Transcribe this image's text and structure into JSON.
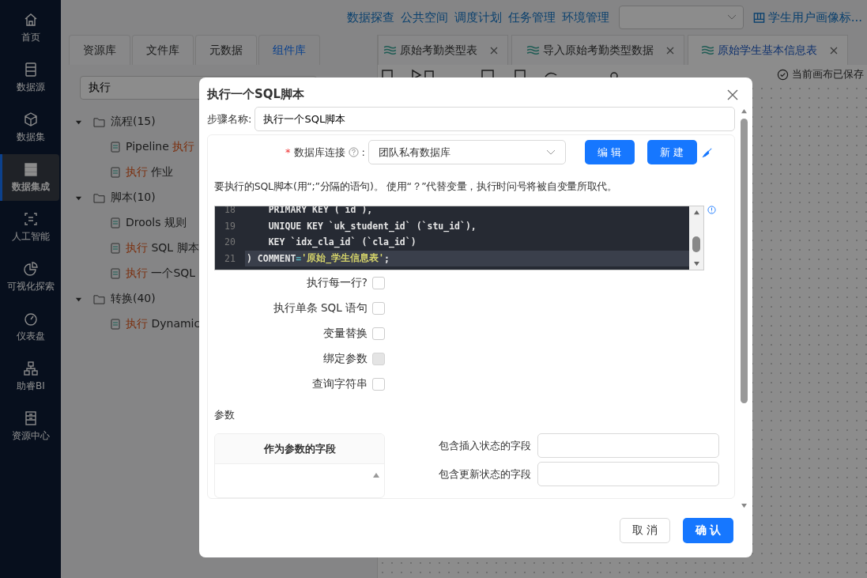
{
  "sidebar": {
    "items": [
      {
        "label": "首页",
        "selected": false
      },
      {
        "label": "数据源",
        "selected": false
      },
      {
        "label": "数据集",
        "selected": false
      },
      {
        "label": "数据集成",
        "selected": true
      },
      {
        "label": "人工智能",
        "selected": false
      },
      {
        "label": "可视化探索",
        "selected": false
      },
      {
        "label": "仪表盘",
        "selected": false
      },
      {
        "label": "助睿BI",
        "selected": false
      },
      {
        "label": "资源中心",
        "selected": false
      }
    ]
  },
  "top_nav": {
    "links": [
      "数据探查",
      "公共空间",
      "调度计划",
      "任务管理",
      "环境管理"
    ],
    "project": "学生用户画像标..."
  },
  "library_tabs": [
    {
      "label": "资源库",
      "selected": false
    },
    {
      "label": "文件库",
      "selected": false
    },
    {
      "label": "元数据",
      "selected": false
    },
    {
      "label": "组件库",
      "selected": true
    }
  ],
  "library_search": {
    "value": "执行"
  },
  "tree": [
    {
      "label": "流程(15)",
      "expanded": true,
      "children": [
        {
          "parts": [
            {
              "text": "Pipeline ",
              "match": false
            },
            {
              "text": "执行",
              "match": true
            }
          ]
        },
        {
          "parts": [
            {
              "text": "执行",
              "match": true
            },
            {
              "text": " 作业",
              "match": false
            }
          ]
        }
      ]
    },
    {
      "label": "脚本(10)",
      "expanded": true,
      "children": [
        {
          "parts": [
            {
              "text": "Drools 规则",
              "match": false
            }
          ]
        },
        {
          "parts": [
            {
              "text": "执行",
              "match": true
            },
            {
              "text": " SQL 脚本",
              "match": false
            }
          ]
        },
        {
          "parts": [
            {
              "text": "执行",
              "match": true
            },
            {
              "text": " 一个SQL",
              "match": false
            }
          ]
        }
      ]
    },
    {
      "label": "转换(40)",
      "expanded": true,
      "children": [
        {
          "parts": [
            {
              "text": "执行",
              "match": true
            },
            {
              "text": " Dynamic",
              "match": false
            }
          ]
        }
      ]
    }
  ],
  "editor_tabs": [
    {
      "label": "原始考勤类型表",
      "selected": false
    },
    {
      "label": "导入原始考勤类型数据",
      "selected": false
    },
    {
      "label": "原始学生基本信息表",
      "selected": true
    }
  ],
  "canvas_status": "当前画布已保存",
  "dialog": {
    "title": "执行一个SQL脚本",
    "step_name": {
      "label": "步骤名称:",
      "value": "执行一个SQL脚本"
    },
    "connection": {
      "required_mark": "*",
      "label": "数据库连接",
      "colon": ":",
      "value": "团队私有数据库"
    },
    "connection_buttons": [
      "编 辑",
      "新 建"
    ],
    "script_hint": "要执行的SQL脚本(用“;”分隔的语句)。 使用“？”代替变量，执行时问号将被自变量所取代。",
    "code_lines": [
      {
        "number": "18",
        "active": false,
        "parts": [
          {
            "text": "    PRIMARY KEY (`id`),",
            "kind": "plain"
          }
        ]
      },
      {
        "number": "19",
        "active": false,
        "parts": [
          {
            "text": "    UNIQUE KEY `uk_student_id` (`stu_id`),",
            "kind": "plain"
          }
        ]
      },
      {
        "number": "20",
        "active": false,
        "parts": [
          {
            "text": "    KEY `idx_cla_id` (`cla_id`)",
            "kind": "plain"
          }
        ]
      },
      {
        "number": "21",
        "active": true,
        "parts": [
          {
            "text": ") COMMENT",
            "kind": "plain"
          },
          {
            "text": "=",
            "kind": "operator"
          },
          {
            "text": "'原始_学生信息表'",
            "kind": "string"
          },
          {
            "text": ";",
            "kind": "plain"
          }
        ]
      }
    ],
    "options": [
      {
        "label": "执行每一行?",
        "checked": false,
        "disabled": false
      },
      {
        "label": "执行单条 SQL 语句",
        "checked": false,
        "disabled": false
      },
      {
        "label": "变量替换",
        "checked": false,
        "disabled": false
      },
      {
        "label": "绑定参数",
        "checked": false,
        "disabled": true
      },
      {
        "label": "查询字符串",
        "checked": false,
        "disabled": false
      }
    ],
    "params_title": "参数",
    "params_table": {
      "columns": [
        "作为参数的字段"
      ]
    },
    "status_fields": [
      {
        "label": "包含插入状态的字段"
      },
      {
        "label": "包含更新状态的字段"
      }
    ],
    "buttons": [
      {
        "label": "取 消",
        "kind": "secondary"
      },
      {
        "label": "确 认",
        "kind": "primary"
      }
    ]
  }
}
